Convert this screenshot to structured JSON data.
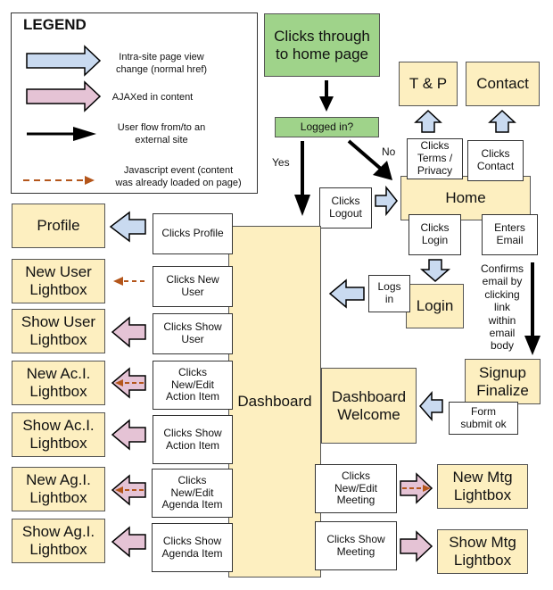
{
  "legend": {
    "title": "LEGEND",
    "items": [
      {
        "icon": "blue-block-arrow",
        "label": "Intra-site page view\nchange (normal href)",
        "color": "#c9daf0"
      },
      {
        "icon": "pink-block-arrow",
        "label": "AJAXed in content",
        "color": "#e5c3d5"
      },
      {
        "icon": "black-arrow",
        "label": "User flow from/to an\nexternal site",
        "color": "#000000"
      },
      {
        "icon": "dashed-orange-arrow",
        "label": "Javascript event (content\nwas already loaded on page)",
        "color": "#b4561b"
      }
    ]
  },
  "colors": {
    "page": "#fdefc0",
    "start": "#9fd38a",
    "intra_site": "#c9daf0",
    "ajax": "#e5c3d5",
    "js_event": "#b4561b"
  },
  "start": {
    "entry": "Clicks through\nto home page",
    "decision": "Logged in?",
    "yes": "Yes",
    "no": "No"
  },
  "pages": {
    "tp": "T & P",
    "contact": "Contact",
    "home": "Home",
    "login": "Login",
    "signup_finalize": "Signup\nFinalize",
    "dashboard": "Dashboard",
    "dashboard_welcome": "Dashboard\nWelcome",
    "profile": "Profile",
    "new_user": "New User\nLightbox",
    "show_user": "Show User\nLightbox",
    "new_aci": "New Ac.I.\nLightbox",
    "show_aci": "Show Ac.I.\nLightbox",
    "new_agi": "New Ag.I.\nLightbox",
    "show_agi": "Show Ag.I.\nLightbox",
    "new_mtg": "New Mtg\nLightbox",
    "show_mtg": "Show Mtg\nLightbox"
  },
  "actions": {
    "terms": "Clicks\nTerms /\nPrivacy",
    "contact": "Clicks\nContact",
    "logout": "Clicks\nLogout",
    "login": "Clicks\nLogin",
    "email": "Enters\nEmail",
    "logs_in": "Logs\nin",
    "confirm": "Confirms\nemail by\nclicking\nlink\nwithin\nemail\nbody",
    "form_ok": "Form\nsubmit ok",
    "profile": "Clicks Profile",
    "new_user": "Clicks New\nUser",
    "show_user": "Clicks Show\nUser",
    "new_aci": "Clicks\nNew/Edit\nAction Item",
    "show_aci": "Clicks Show\nAction Item",
    "new_agi": "Clicks\nNew/Edit\nAgenda Item",
    "show_agi": "Clicks Show\nAgenda Item",
    "new_mtg": "Clicks\nNew/Edit\nMeeting",
    "show_mtg": "Clicks Show\nMeeting"
  }
}
